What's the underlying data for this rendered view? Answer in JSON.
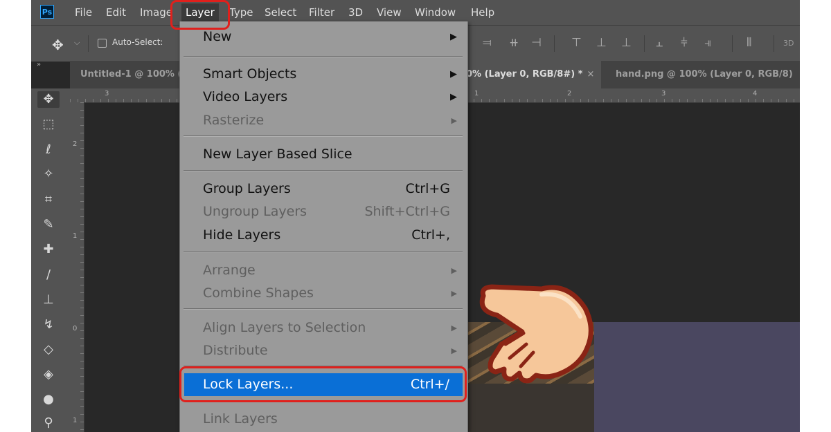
{
  "menubar": {
    "logo": "Ps",
    "items": [
      "File",
      "Edit",
      "Image",
      "Layer",
      "Type",
      "Select",
      "Filter",
      "3D",
      "View",
      "Window",
      "Help"
    ]
  },
  "options_bar": {
    "auto_select_label": "Auto-Select:",
    "threed_label": "3D"
  },
  "tabs": [
    {
      "label": "Untitled-1 @ 100% (",
      "active": false
    },
    {
      "label": "0% (Layer 0, RGB/8#) *",
      "active": true,
      "close": "×"
    },
    {
      "label": "hand.png @ 100% (Layer 0, RGB/8)",
      "active": false
    }
  ],
  "ruler": {
    "top_numbers": [
      "3",
      "1",
      "2",
      "3",
      "4"
    ],
    "left_numbers": [
      "2",
      "1",
      "0",
      "1"
    ]
  },
  "layer_menu": {
    "items": [
      {
        "label": "New",
        "shortcut": "",
        "submenu": true,
        "disabled": false
      },
      {
        "label": "Smart Objects",
        "shortcut": "",
        "submenu": true,
        "disabled": false
      },
      {
        "label": "Video Layers",
        "shortcut": "",
        "submenu": true,
        "disabled": false
      },
      {
        "label": "Rasterize",
        "shortcut": "",
        "submenu": true,
        "disabled": true
      },
      {
        "label": "New Layer Based Slice",
        "shortcut": "",
        "submenu": false,
        "disabled": false
      },
      {
        "label": "Group Layers",
        "shortcut": "Ctrl+G",
        "submenu": false,
        "disabled": false
      },
      {
        "label": "Ungroup Layers",
        "shortcut": "Shift+Ctrl+G",
        "submenu": false,
        "disabled": true
      },
      {
        "label": "Hide Layers",
        "shortcut": "Ctrl+,",
        "submenu": false,
        "disabled": false
      },
      {
        "label": "Arrange",
        "shortcut": "",
        "submenu": true,
        "disabled": true
      },
      {
        "label": "Combine Shapes",
        "shortcut": "",
        "submenu": true,
        "disabled": true
      },
      {
        "label": "Align Layers to Selection",
        "shortcut": "",
        "submenu": true,
        "disabled": true
      },
      {
        "label": "Distribute",
        "shortcut": "",
        "submenu": true,
        "disabled": true
      },
      {
        "label": "Lock Layers...",
        "shortcut": "Ctrl+/",
        "submenu": false,
        "disabled": false,
        "highlighted": true
      },
      {
        "label": "Link Layers",
        "shortcut": "",
        "submenu": false,
        "disabled": true
      }
    ]
  },
  "colors": {
    "menu_highlight": "#0a6fd6",
    "annotation_red": "#e0201c",
    "menu_bg": "#9a9a9a"
  }
}
